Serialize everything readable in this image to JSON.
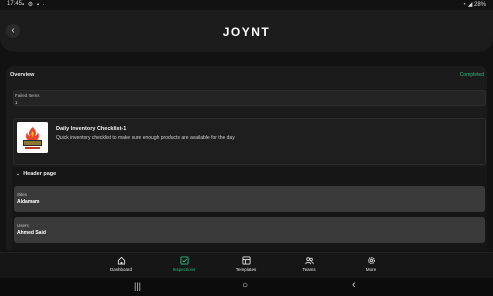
{
  "status_bar": {
    "time": "17:45",
    "battery": "28%"
  },
  "header": {
    "logo": "JOYNT",
    "back_glyph": "‹"
  },
  "overview": {
    "title": "Overview",
    "status": "Completed",
    "failed_items_label": "Failed Items",
    "failed_items_value": "1"
  },
  "checklist": {
    "title": "Daily Inventory Checklist-1",
    "description": "Quick inventory checklist to make sure enough products are available for the day"
  },
  "section": {
    "title": "Header page",
    "fields": [
      {
        "label": "Sites",
        "value": "Aldamam"
      },
      {
        "label": "Users",
        "value": "Ahmed Said"
      }
    ]
  },
  "nav": {
    "items": [
      {
        "label": "Dashboard",
        "icon": "home-icon"
      },
      {
        "label": "Inspections",
        "icon": "checkbox-icon",
        "active": true
      },
      {
        "label": "Templates",
        "icon": "template-icon"
      },
      {
        "label": "Teams",
        "icon": "team-icon"
      },
      {
        "label": "More",
        "icon": "gear-icon"
      }
    ]
  },
  "colors": {
    "accent": "#2dbb7d",
    "background": "#121212",
    "card": "#1b1b1b"
  }
}
